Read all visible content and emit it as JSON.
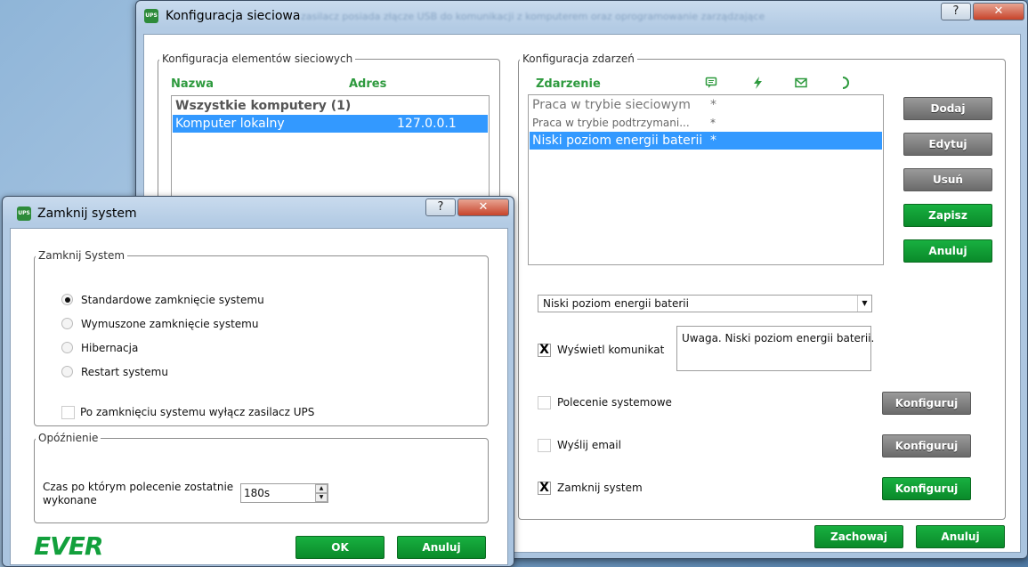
{
  "background_text": "zasilacz posiada złącze USB do komunikacji z komputerem oraz oprogramowanie zarządzające",
  "main_window": {
    "title": "Konfiguracja sieciowa",
    "icon_text": "UPS",
    "help_label": "?",
    "close_label": "✕",
    "network_group": {
      "label": "Konfiguracja elementów sieciowych",
      "col_name": "Nazwa",
      "col_address": "Adres",
      "group_row": "Wszystkie komputery (1)",
      "rows": [
        {
          "name": "Komputer lokalny",
          "address": "127.0.0.1"
        }
      ]
    },
    "events_group": {
      "label": "Konfiguracja zdarzeń",
      "col_event": "Zdarzenie",
      "col_icons": [
        "message-icon",
        "lightning-icon",
        "mail-icon",
        "moon-icon"
      ],
      "rows": [
        {
          "name": "Praca w trybie sieciowym",
          "mark": "*"
        },
        {
          "name": "Praca w trybie podtrzymani...",
          "mark": "*"
        },
        {
          "name": "Niski poziom energii baterii",
          "mark": "*"
        }
      ],
      "buttons": {
        "add": "Dodaj",
        "edit": "Edytuj",
        "delete": "Usuń",
        "save": "Zapisz",
        "cancel": "Anuluj"
      },
      "event_select": "Niski poziom energii baterii",
      "show_message_label": "Wyświetl komunikat",
      "show_message_checked": "X",
      "message_text": "Uwaga. Niski poziom energii baterii.",
      "system_command_label": "Polecenie systemowe",
      "send_email_label": "Wyślij email",
      "shutdown_label": "Zamknij system",
      "shutdown_checked": "X",
      "configure_label": "Konfiguruj"
    },
    "footer": {
      "keep": "Zachowaj",
      "cancel": "Anuluj"
    }
  },
  "dialog": {
    "title": "Zamknij system",
    "icon_text": "UPS",
    "help_label": "?",
    "close_label": "✕",
    "shutdown_group": {
      "label": "Zamknij System",
      "options": [
        "Standardowe zamknięcie systemu",
        "Wymuszone zamknięcie systemu",
        "Hibernacja",
        "Restart systemu"
      ],
      "selected_index": 0,
      "ups_off_label": "Po zamknięciu systemu wyłącz zasilacz UPS"
    },
    "delay_group": {
      "label": "Opóźnienie",
      "delay_label_line1": "Czas po którym polecenie zostatnie",
      "delay_label_line2": "wykonane",
      "delay_value": "180s",
      "up_arrow": "▲",
      "down_arrow": "▼"
    },
    "logo_text": "EVER",
    "ok": "OK",
    "cancel": "Anuluj"
  },
  "colors": {
    "accent_green": "#2e9a3e",
    "selection": "#3399ff",
    "button_green": "#0f9e35"
  }
}
